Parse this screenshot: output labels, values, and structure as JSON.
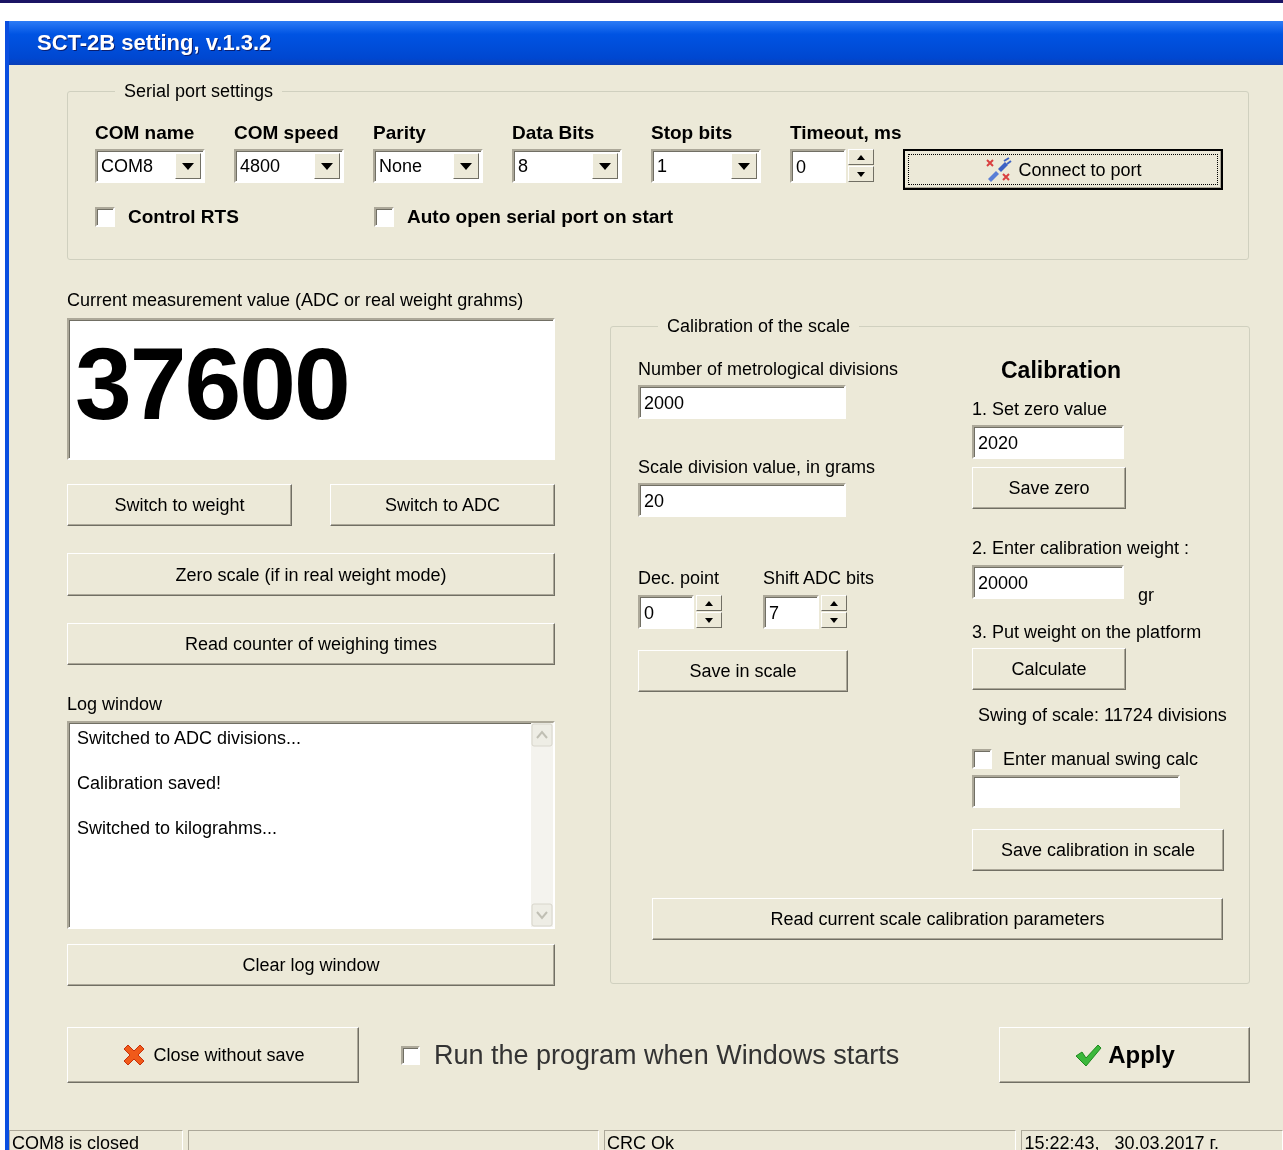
{
  "window": {
    "title": "SCT-2B setting, v.1.3.2"
  },
  "serial_port": {
    "title": "Serial port settings",
    "fields": [
      {
        "kind": "dropdown",
        "label": "COM name",
        "value": "COM8"
      },
      {
        "kind": "dropdown",
        "label": "COM speed",
        "value": "4800"
      },
      {
        "kind": "dropdown",
        "label": "Parity",
        "value": "None"
      },
      {
        "kind": "dropdown",
        "label": "Data Bits",
        "value": "8"
      },
      {
        "kind": "dropdown",
        "label": "Stop bits",
        "value": "1"
      },
      {
        "kind": "spinner",
        "label": "Timeout, ms",
        "value": "0"
      }
    ],
    "connect_button": "Connect to port",
    "options": [
      {
        "label": "Control RTS",
        "checked": false
      },
      {
        "label": "Auto open serial port on start",
        "checked": false
      }
    ]
  },
  "measurement": {
    "label": "Current measurement value (ADC or real weight grahms)",
    "value": "37600"
  },
  "actions": {
    "switch_weight": "Switch to weight",
    "switch_adc": "Switch to ADC",
    "zero": "Zero scale (if in real weight mode)",
    "read_counter": "Read counter of weighing times"
  },
  "log": {
    "label": "Log window",
    "lines": [
      "Switched to ADC divisions...",
      "Calibration saved!",
      "Switched to kilograhms..."
    ],
    "clear_button": "Clear log window"
  },
  "calibration_scale": {
    "title": "Calibration of the scale",
    "divisions_label": "Number of metrological divisions",
    "divisions": "2000",
    "division_value_label": "Scale division value, in grams",
    "division_value": "20",
    "dec_point_label": "Dec. point",
    "dec_point": "0",
    "shift_label": "Shift ADC bits",
    "shift": "7",
    "save_button": "Save in scale",
    "heading": "Calibration",
    "zero_label": "1. Set zero value",
    "zero": "2020",
    "save_zero_button": "Save zero",
    "weight_label": "2. Enter calibration weight :",
    "weight": "20000",
    "weight_unit": "gr",
    "put_label": "3. Put weight on the platform",
    "calculate_button": "Calculate",
    "swing": "Swing of scale: 11724 divisions",
    "manual_swing": {
      "label": "Enter manual swing calc",
      "checked": false
    },
    "save_calibration_button": "Save calibration in scale",
    "read_button": "Read current scale calibration parameters"
  },
  "footer": {
    "close_button": "Close without save",
    "autostart": {
      "label": "Run the program when Windows starts",
      "checked": false
    },
    "apply_button": "Apply"
  },
  "status_bar": [
    {
      "kind": "text",
      "text": "COM8 is closed"
    },
    {
      "kind": "spacer"
    },
    {
      "kind": "text",
      "text": "CRC Ok"
    },
    {
      "kind": "text",
      "text": "15:22:43,   30.03.2017 г."
    }
  ]
}
